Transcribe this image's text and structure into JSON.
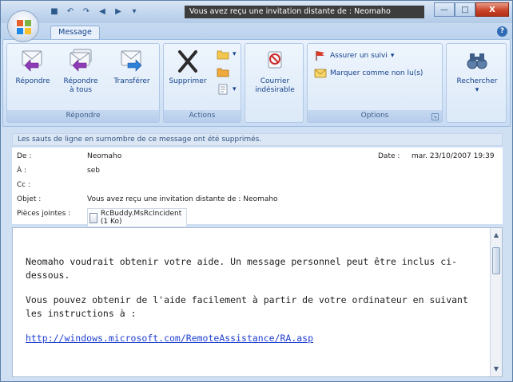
{
  "window": {
    "title": "Vous avez reçu une invitation distante de : Neomaho",
    "minimize": "—",
    "maximize": "□",
    "close": "X"
  },
  "ribbon": {
    "tab": "Message",
    "groups": {
      "respond": {
        "label": "Répondre",
        "reply": "Répondre",
        "reply_all_line1": "Répondre",
        "reply_all_line2": "à tous",
        "forward": "Transférer"
      },
      "actions": {
        "label": "Actions",
        "delete": "Supprimer"
      },
      "junk": {
        "label_line1": "Courrier",
        "label_line2": "indésirable"
      },
      "options": {
        "label": "Options",
        "follow_up": "Assurer un suivi",
        "mark_unread": "Marquer comme non lu(s)"
      },
      "find": {
        "label": "Rechercher"
      }
    }
  },
  "infobar": "Les sauts de ligne en surnombre de ce message ont été supprimés.",
  "headers": {
    "from_label": "De :",
    "from": "Neomaho",
    "date_label": "Date :",
    "date": "mar. 23/10/2007 19:39",
    "to_label": "À :",
    "to": "seb",
    "cc_label": "Cc :",
    "subject_label": "Objet :",
    "subject": "Vous avez reçu une invitation distante de : Neomaho",
    "attachments_label": "Pièces jointes :",
    "attachment": "RcBuddy.MsRcIncident (1 Ko)"
  },
  "body": {
    "paragraph1": "Neomaho voudrait obtenir votre aide. Un message personnel peut être inclus ci-dessous.",
    "paragraph2": "Vous pouvez obtenir de l'aide facilement à partir de votre ordinateur en suivant les instructions à :",
    "link": "http://windows.microsoft.com/RemoteAssistance/RA.asp"
  },
  "colors": {
    "ribbon_text": "#15428b",
    "link": "#1f3fd1",
    "close_button": "#c9452a"
  }
}
